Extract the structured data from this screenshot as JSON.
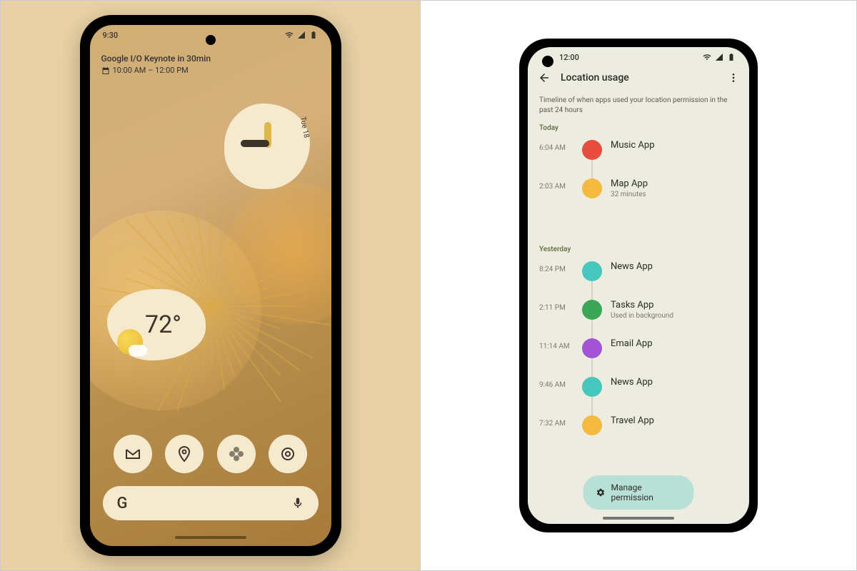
{
  "left": {
    "status_time": "9:30",
    "event_title": "Google I/O Keynote in 30min",
    "event_time": "10:00 AM – 12:00 PM",
    "clock_date": "Tue 18",
    "weather_temp": "72°",
    "search_letter": "G",
    "fav_icons": [
      "gmail-icon",
      "maps-icon",
      "photos-icon",
      "camera-icon"
    ]
  },
  "right": {
    "status_time": "12:00",
    "page_title": "Location usage",
    "page_desc": "Timeline of when apps used your location permission in the past 24 hours",
    "today_label": "Today",
    "yesterday_label": "Yesterday",
    "today": [
      {
        "time": "6:04 AM",
        "app": "Music App",
        "sub": "",
        "color": "red"
      },
      {
        "time": "2:03 AM",
        "app": "Map App",
        "sub": "32 minutes",
        "color": "yellow"
      }
    ],
    "yesterday": [
      {
        "time": "8:24 PM",
        "app": "News App",
        "sub": "",
        "color": "teal"
      },
      {
        "time": "2:11 PM",
        "app": "Tasks App",
        "sub": "Used in background",
        "color": "green"
      },
      {
        "time": "11:14 AM",
        "app": "Email App",
        "sub": "",
        "color": "purple"
      },
      {
        "time": "9:46 AM",
        "app": "News App",
        "sub": "",
        "color": "teal"
      },
      {
        "time": "7:32 AM",
        "app": "Travel App",
        "sub": "",
        "color": "yellow"
      }
    ],
    "manage_label": "Manage permission"
  }
}
